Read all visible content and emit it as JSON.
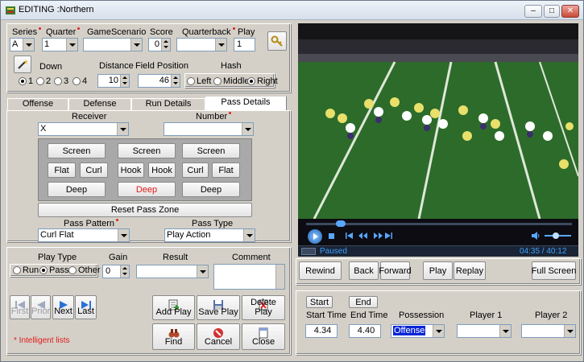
{
  "window": {
    "title": "EDITING :Northern",
    "min": "–",
    "max": "□",
    "close": "✕"
  },
  "top": {
    "series": {
      "label": "Series",
      "value": "A"
    },
    "quarter": {
      "label": "Quarter",
      "value": "1"
    },
    "game_scenario": {
      "label": "GameScenario",
      "value": ""
    },
    "score": {
      "label": "Score",
      "value": "0"
    },
    "quarterback": {
      "label": "Quarterback",
      "value": ""
    },
    "play": {
      "label": "Play",
      "value": "1"
    },
    "down": {
      "label": "Down",
      "options": [
        "1",
        "2",
        "3",
        "4"
      ],
      "selected": "1"
    },
    "distance": {
      "label": "Distance",
      "value": "10"
    },
    "field_position": {
      "label": "Field Position",
      "value": "46"
    },
    "hash": {
      "label": "Hash",
      "options": [
        "Left",
        "Middle",
        "Right"
      ],
      "selected": "Right"
    }
  },
  "tabs": [
    "Offense",
    "Defense",
    "Run Details",
    "Pass Details"
  ],
  "active_tab": "Pass Details",
  "pass": {
    "receiver": {
      "label": "Receiver",
      "value": "X"
    },
    "number": {
      "label": "Number",
      "value": ""
    },
    "routes": {
      "row1": [
        "Screen",
        "Screen",
        "Screen"
      ],
      "row2": [
        "Flat",
        "Curl",
        "Hook",
        "Hook",
        "Curl",
        "Flat"
      ],
      "row3": [
        "Deep",
        "Deep",
        "Deep"
      ]
    },
    "reset": "Reset Pass Zone",
    "pattern": {
      "label": "Pass Pattern",
      "value": "Curl Flat"
    },
    "type": {
      "label": "Pass Type",
      "value": "Play Action"
    }
  },
  "bottom": {
    "play_type": {
      "label": "Play Type",
      "options": [
        "Run",
        "Pass",
        "Other"
      ],
      "selected": "Pass"
    },
    "gain": {
      "label": "Gain",
      "value": "0"
    },
    "result": {
      "label": "Result",
      "value": ""
    },
    "comment": {
      "label": "Comment",
      "value": ""
    },
    "nav": [
      "First",
      "Prior",
      "Next",
      "Last"
    ],
    "actions": [
      "Add Play",
      "Save Play",
      "Delete Play",
      "Find",
      "Cancel",
      "Close"
    ],
    "note": "* Intelligent lists"
  },
  "video": {
    "status": "Paused",
    "time": "04:35 / 40:12",
    "buttons": [
      "Rewind",
      "Back",
      "Forward",
      "Play",
      "Replay",
      "Full Screen"
    ]
  },
  "clip": {
    "start_btn": "Start",
    "end_btn": "End",
    "start_label": "Start Time",
    "end_label": "End Time",
    "start_value": "4.34",
    "end_value": "4.40",
    "possession": {
      "label": "Possession",
      "value": "Offense"
    },
    "player1": {
      "label": "Player 1",
      "value": ""
    },
    "player2": {
      "label": "Player 2",
      "value": ""
    }
  },
  "colors": {
    "accent": "#0a24d6",
    "required": "#d22222",
    "paused": "#3aa0ff",
    "note": "#e01b1b"
  }
}
